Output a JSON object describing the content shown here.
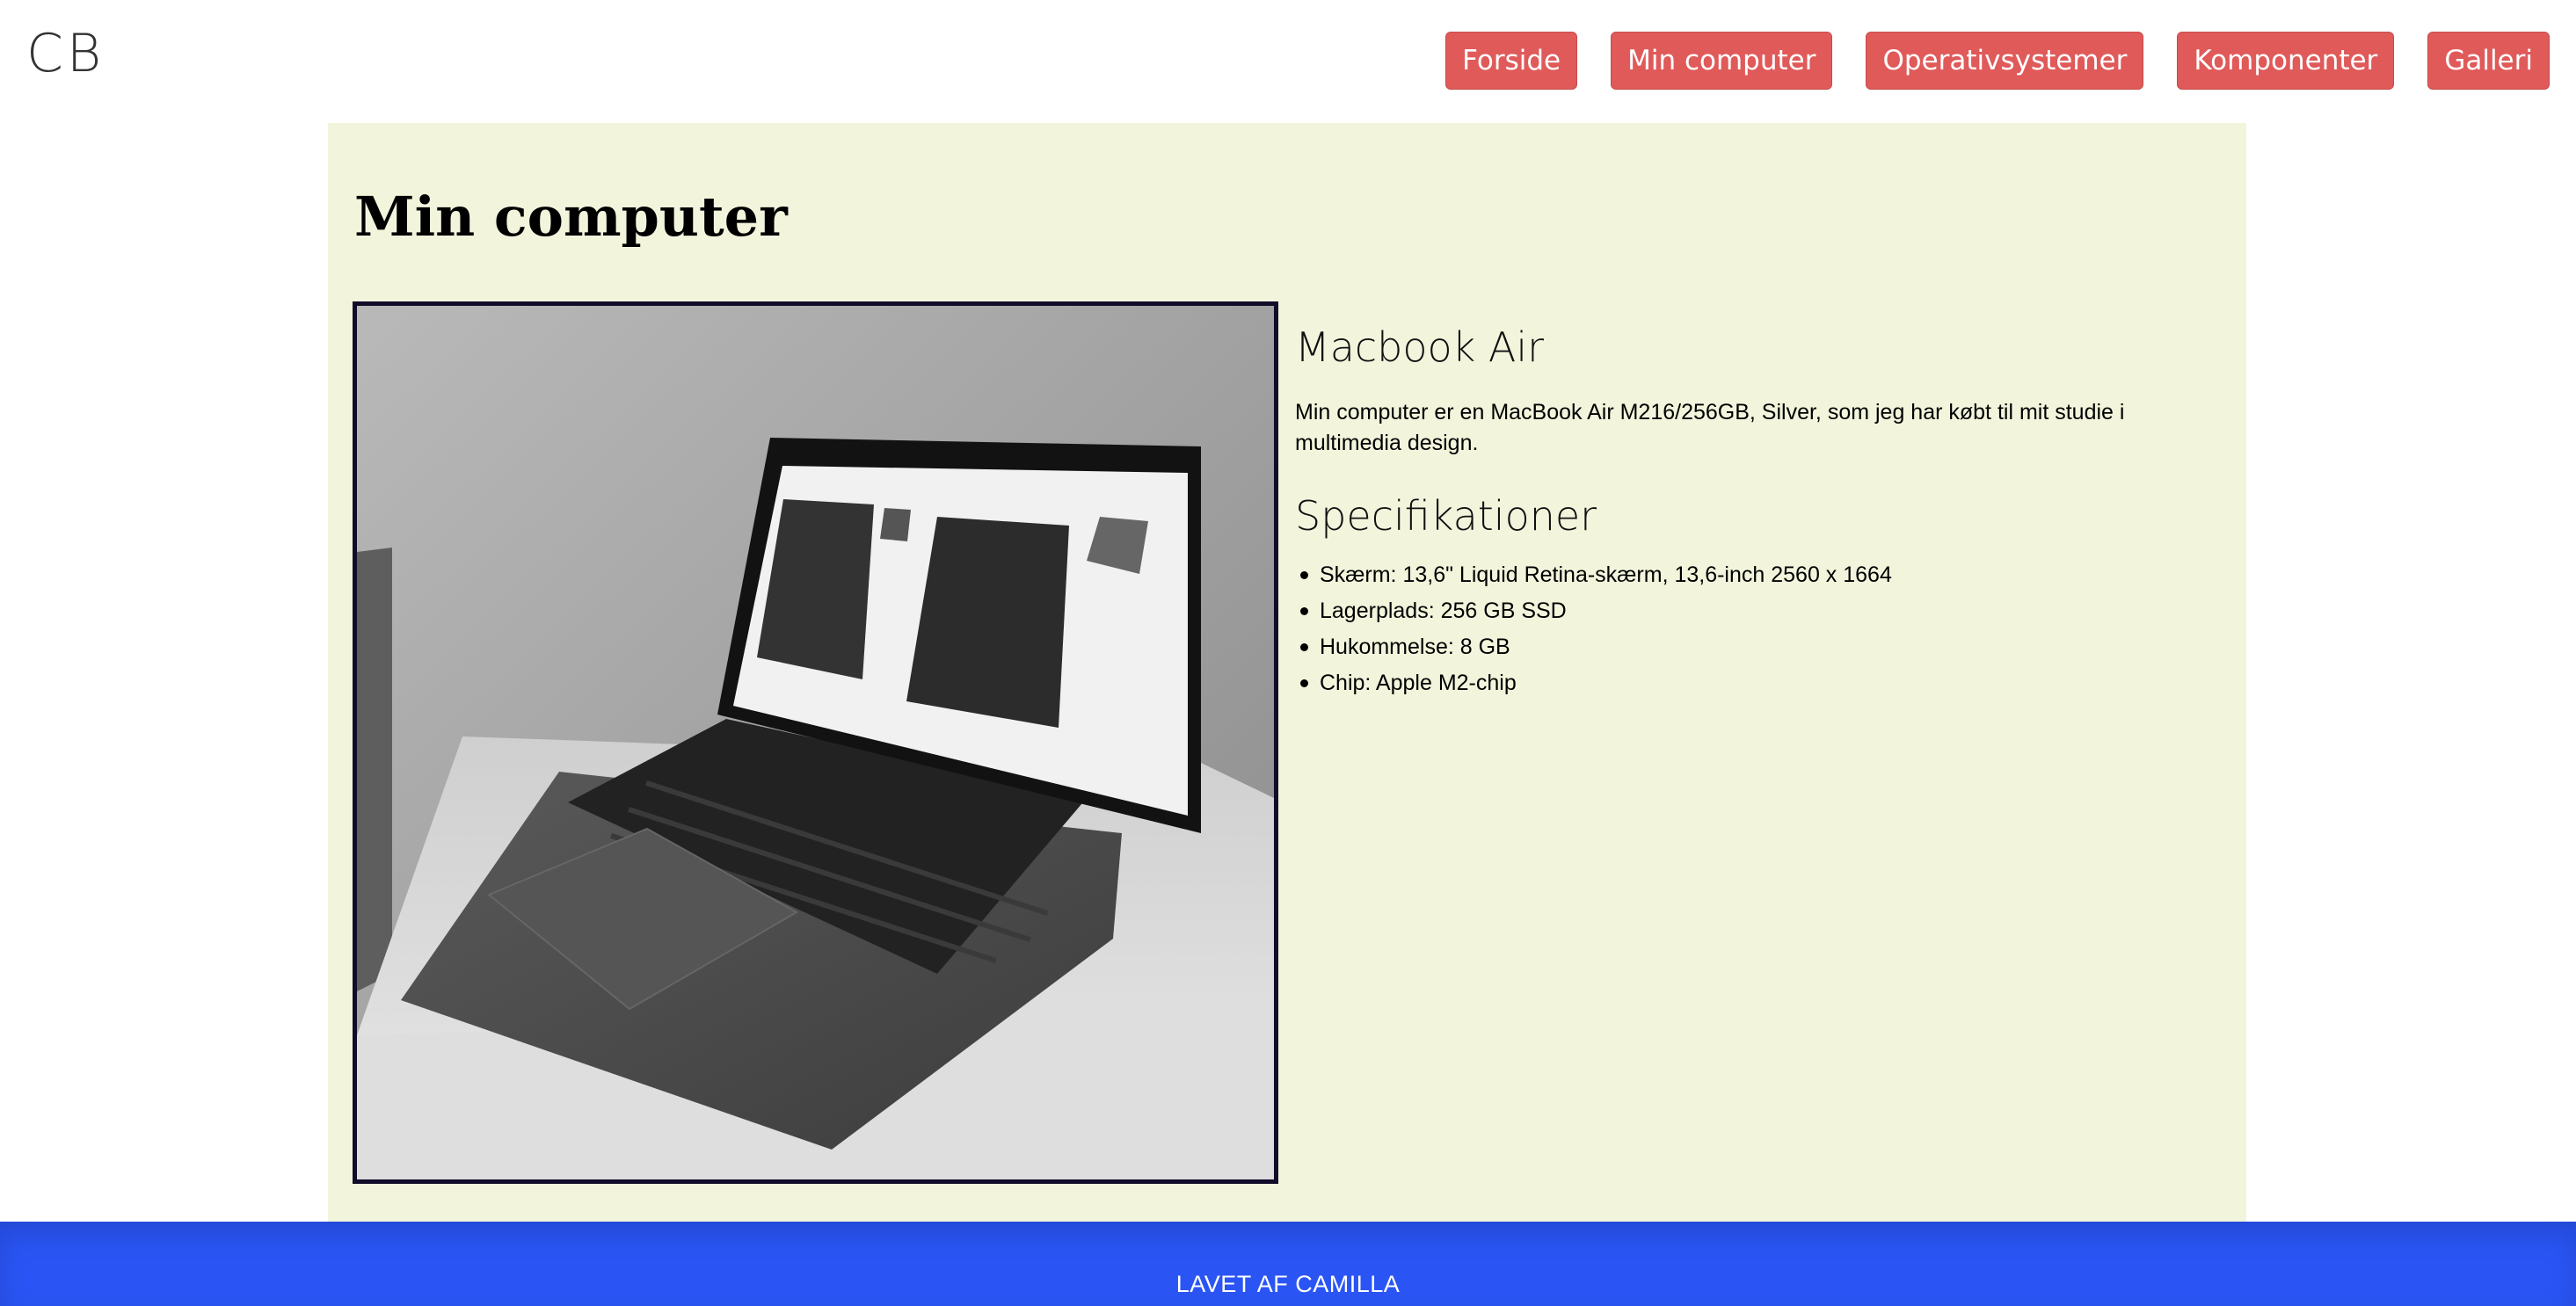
{
  "header": {
    "logo": "CB",
    "nav": [
      "Forside",
      "Min computer",
      "Operativsystemer",
      "Komponenter",
      "Galleri"
    ]
  },
  "main": {
    "title": "Min computer",
    "product_title": "Macbook Air",
    "description": "Min computer er en MacBook Air M216/256GB, Silver, som jeg har købt til mit studie i multimedia design.",
    "specs_title": "Specifikationer",
    "specs": [
      "Skærm: 13,6\" Liquid Retina-skærm, 13,6-inch 2560 x 1664",
      "Lagerplads: 256 GB SSD",
      "Hukommelse: 8 GB",
      "Chip: Apple M2-chip"
    ]
  },
  "footer": {
    "text": "LAVET AF CAMILLA"
  },
  "colors": {
    "nav_button": "#e05a5a",
    "main_background": "#f2f5dc",
    "footer": "#2a55f4",
    "photo_border": "#120c2a"
  },
  "icons": {
    "photo": "laptop-photo"
  }
}
